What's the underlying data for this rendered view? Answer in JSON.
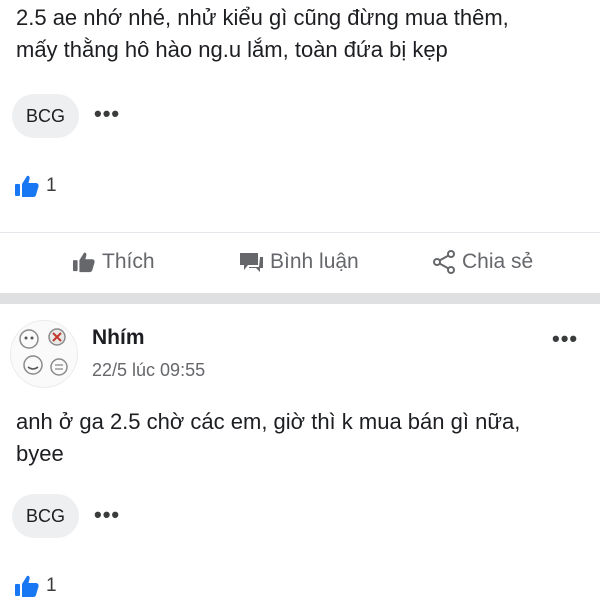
{
  "post1": {
    "text_line1": "2.5 ae nhớ nhé, nhử kiểu gì cũng đừng mua thêm,",
    "text_line2": "mấy thằng hô hào ng.u lắm, toàn đứa bị kẹp",
    "tag": "BCG",
    "more": "•••",
    "like_count": "1"
  },
  "actions": {
    "like": "Thích",
    "comment": "Bình luận",
    "share": "Chia sẻ"
  },
  "post2": {
    "author": "Nhím",
    "time": "22/5 lúc 09:55",
    "text_line1": "anh ở ga 2.5 chờ các em, giờ thì k mua bán gì nữa,",
    "text_line2": "byee",
    "tag": "BCG",
    "more": "•••",
    "like_count": "1"
  },
  "colors": {
    "like_blue": "#1877f2",
    "muted_text": "#65676b",
    "pill_bg": "#eeeff1"
  },
  "icons": [
    "like-reaction-icon",
    "thumbs-up-icon",
    "comment-icon",
    "share-icon",
    "more-options-icon"
  ]
}
